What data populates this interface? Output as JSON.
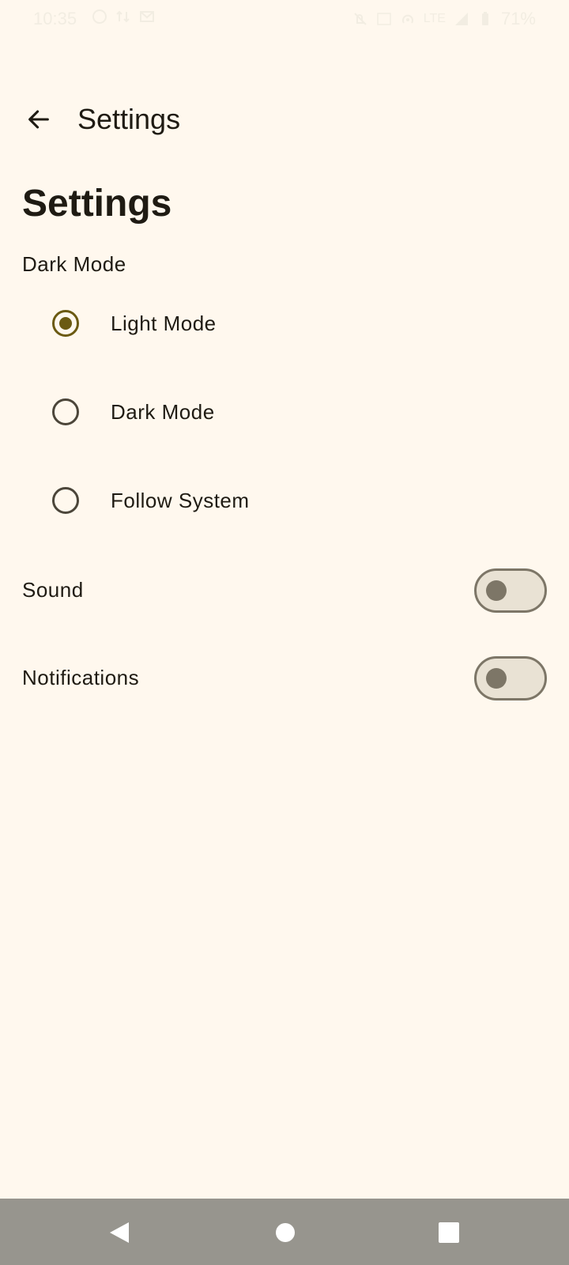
{
  "status_bar": {
    "time": "10:35",
    "battery": "71%",
    "network": "LTE",
    "icons_left": [
      "circle-icon",
      "signal-arrows-icon",
      "gmail-icon"
    ],
    "icons_right": [
      "mute-icon",
      "volte-icon",
      "hotspot-icon",
      "lte-icon",
      "signal-icon",
      "battery-icon"
    ]
  },
  "app_bar": {
    "title": "Settings",
    "back_icon": "arrow-back-icon"
  },
  "page": {
    "title": "Settings"
  },
  "dark_mode": {
    "section_label": "Dark Mode",
    "options": [
      {
        "label": "Light Mode",
        "selected": true
      },
      {
        "label": "Dark Mode",
        "selected": false
      },
      {
        "label": "Follow System",
        "selected": false
      }
    ]
  },
  "toggles": [
    {
      "label": "Sound",
      "on": false
    },
    {
      "label": "Notifications",
      "on": false
    }
  ],
  "nav_bar": {
    "buttons": [
      "back-triangle-icon",
      "home-circle-icon",
      "recents-square-icon"
    ]
  },
  "colors": {
    "background": "#fff8ee",
    "accent": "#6b5a12",
    "text": "#1f1b13",
    "switch_outline": "#7d7667",
    "nav_bar": "#97958e"
  }
}
